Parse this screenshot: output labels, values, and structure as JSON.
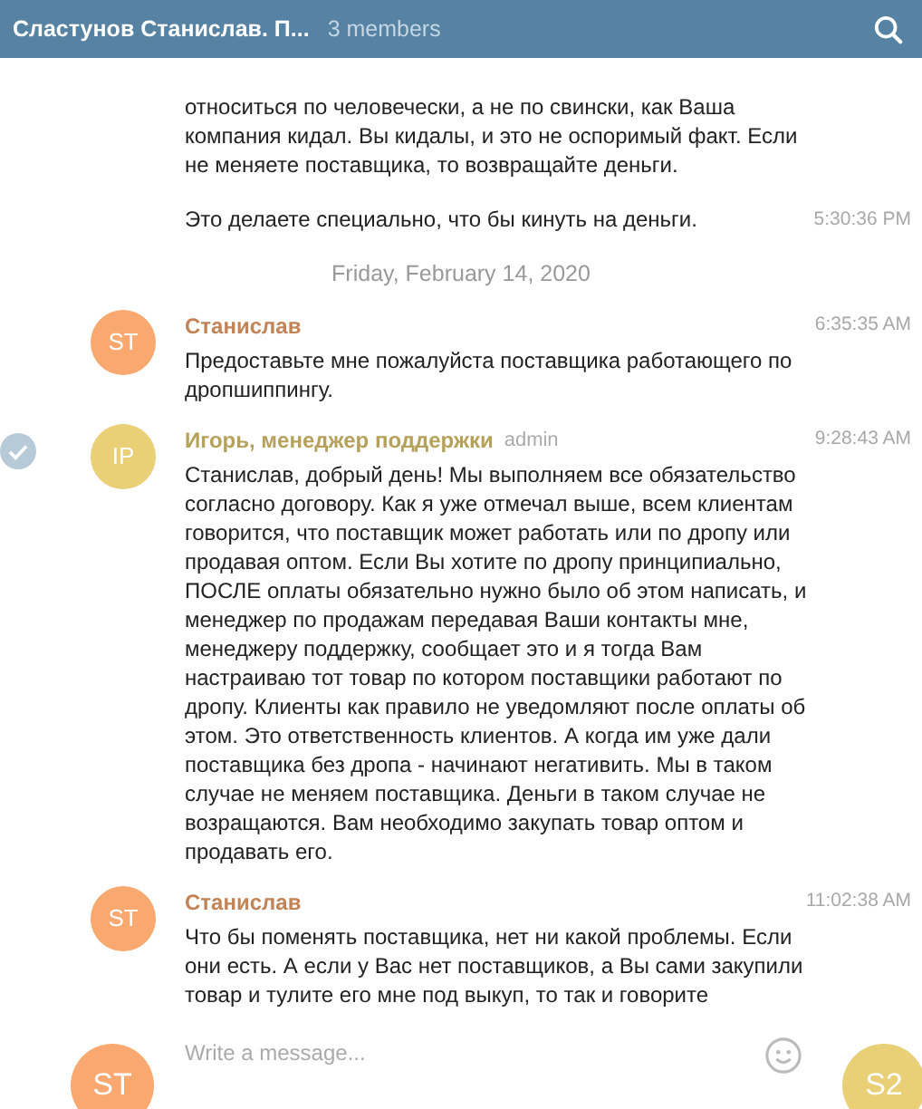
{
  "header": {
    "title": "Сластунов Станислав. П...",
    "members": "3 members"
  },
  "feed": [
    {
      "kind": "continuation",
      "paragraphs": [
        {
          "text": "относиться по человечески, а не по свински, как Ваша компания кидал. Вы кидалы, и это не оспоримый факт. Если не меняете поставщика, то возвращайте деньги."
        },
        {
          "text": "Это делаете специально, что бы кинуть на деньги.",
          "time": "5:30:36 PM"
        }
      ]
    },
    {
      "kind": "date",
      "text": "Friday, February 14, 2020"
    },
    {
      "kind": "message",
      "selected": false,
      "color": "#f9a870",
      "avatar": "ST",
      "author": "Станислав",
      "time": "6:35:35 AM",
      "paragraphs": [
        {
          "text": "Предоставьте мне пожалуйста поставщика работающего по дропшиппингу."
        }
      ]
    },
    {
      "kind": "message",
      "selected": true,
      "color": "#e9cf75",
      "avatar": "IP",
      "author": "Игорь, менеджер поддержки",
      "role": "admin",
      "time": "9:28:43 AM",
      "paragraphs": [
        {
          "text": "Станислав, добрый день! Мы выполняем все обязательство согласно договору.  Как я уже отмечал выше, всем клиентам говорится, что поставщик может работать или по дропу или продавая оптом. Если Вы хотите по дропу принципиально, ПОСЛЕ оплаты обязательно нужно было об этом написать, и менеджер по продажам передавая Ваши контакты мне, менеджеру поддержку, сообщает это и я тогда Вам настраиваю тот товар по котором поставщики работают по дропу. Клиенты как правило не уведомляют после оплаты об этом. Это ответственность клиентов. А когда им уже дали поставщика без дропа - начинают негативить. Мы в таком случае не меняем поставщика. Деньги в таком случае не возращаются. Вам необходимо закупать товар оптом и продавать его."
        }
      ]
    },
    {
      "kind": "message",
      "selected": false,
      "color": "#f9a870",
      "avatar": "ST",
      "author": "Станислав",
      "time": "11:02:38 AM",
      "paragraphs": [
        {
          "text": "Что бы поменять поставщика, нет ни какой проблемы. Если они есть. А если у Вас нет поставщиков, а Вы сами закупили товар и тулите его мне под выкуп, то так и говорите"
        }
      ]
    }
  ],
  "composer": {
    "placeholder": "Write a message...",
    "my_avatar": "ST",
    "peer_avatar": "S2"
  }
}
